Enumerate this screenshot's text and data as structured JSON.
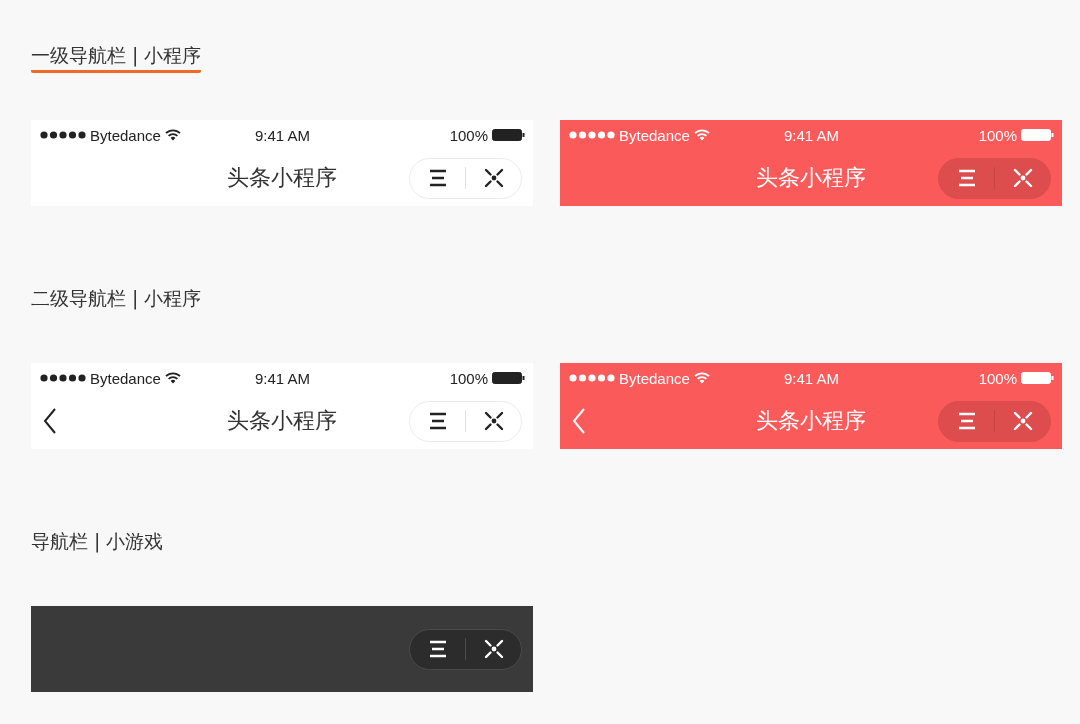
{
  "sections": [
    {
      "heading": "一级导航栏 | 小程序",
      "underlined": true,
      "bars": [
        {
          "kind": "light",
          "status_bar": {
            "carrier": "Bytedance",
            "time": "9:41 AM",
            "battery": "100%"
          },
          "title": "头条小程序",
          "back_button": false
        },
        {
          "kind": "red",
          "status_bar": {
            "carrier": "Bytedance",
            "time": "9:41 AM",
            "battery": "100%"
          },
          "title": "头条小程序",
          "back_button": false
        }
      ]
    },
    {
      "heading": "二级导航栏 | 小程序",
      "underlined": false,
      "bars": [
        {
          "kind": "light",
          "status_bar": {
            "carrier": "Bytedance",
            "time": "9:41 AM",
            "battery": "100%"
          },
          "title": "头条小程序",
          "back_button": true
        },
        {
          "kind": "red",
          "status_bar": {
            "carrier": "Bytedance",
            "time": "9:41 AM",
            "battery": "100%"
          },
          "title": "头条小程序",
          "back_button": true
        }
      ]
    },
    {
      "heading": "导航栏 | 小游戏",
      "underlined": false,
      "bars": [
        {
          "kind": "dark",
          "back_button": false
        }
      ]
    }
  ]
}
